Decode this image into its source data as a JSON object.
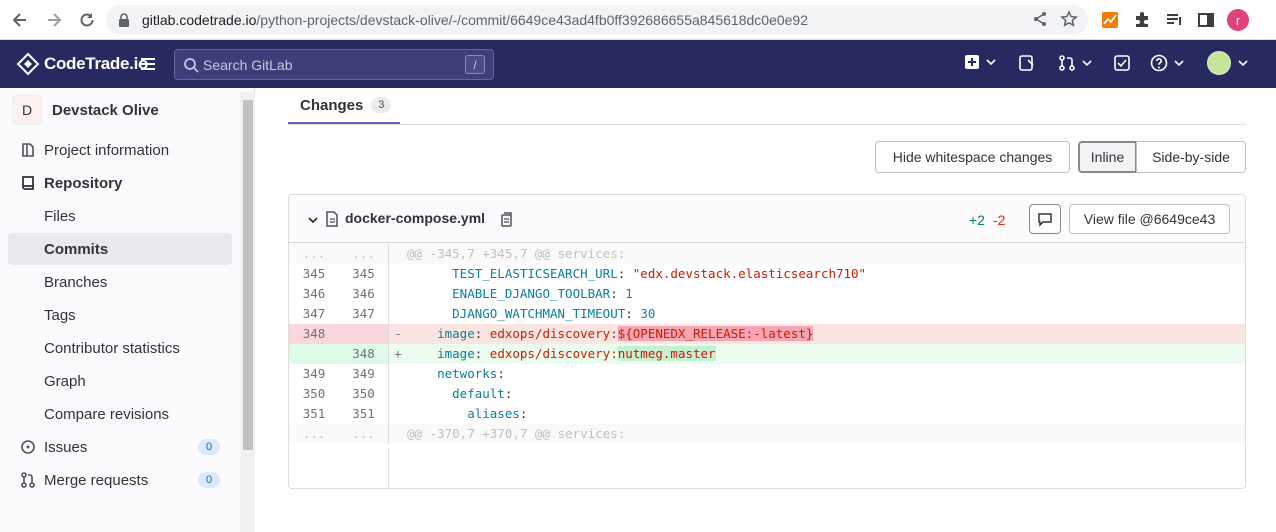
{
  "browser": {
    "url_host": "gitlab.codetrade.io",
    "url_path": "/python-projects/devstack-olive/-/commit/6649ce43ad4fb0ff392686655a845618dc0e0e92",
    "profile_initial": "r"
  },
  "topnav": {
    "logo_text": "CodeTrade.io",
    "search_placeholder": "Search GitLab",
    "search_shortcut": "/"
  },
  "sidebar": {
    "project_initial": "D",
    "project_name": "Devstack Olive",
    "items": [
      {
        "label": "Project information",
        "icon": "project-info-icon"
      },
      {
        "label": "Repository",
        "icon": "repository-icon"
      },
      {
        "label": "Files"
      },
      {
        "label": "Commits"
      },
      {
        "label": "Branches"
      },
      {
        "label": "Tags"
      },
      {
        "label": "Contributor statistics"
      },
      {
        "label": "Graph"
      },
      {
        "label": "Compare revisions"
      },
      {
        "label": "Issues",
        "icon": "issues-icon",
        "badge": "0"
      },
      {
        "label": "Merge requests",
        "icon": "merge-request-icon",
        "badge": "0"
      }
    ]
  },
  "main": {
    "tab_label": "Changes",
    "tab_count": "3",
    "hide_whitespace": "Hide whitespace changes",
    "inline": "Inline",
    "side_by_side": "Side-by-side"
  },
  "diff": {
    "file_name": "docker-compose.yml",
    "additions": "+2",
    "deletions": "-2",
    "view_file": "View file @6649ce43",
    "lines": [
      {
        "type": "match",
        "old": "...",
        "new": "...",
        "text": "@@ -345,7 +345,7 @@ services:"
      },
      {
        "type": "ctx",
        "old": "345",
        "new": "345",
        "key": "      TEST_ELASTICSEARCH_URL",
        "sep": ": ",
        "val": "\"edx.devstack.elasticsearch710\"",
        "val_class": "s"
      },
      {
        "type": "ctx",
        "old": "346",
        "new": "346",
        "key": "      ENABLE_DJANGO_TOOLBAR",
        "sep": ": ",
        "val": "1",
        "val_class": "n"
      },
      {
        "type": "ctx",
        "old": "347",
        "new": "347",
        "key": "      DJANGO_WATCHMAN_TIMEOUT",
        "sep": ": ",
        "val": "30",
        "val_class": "n"
      },
      {
        "type": "old",
        "old": "348",
        "new": "",
        "mark": "-",
        "key": "    image",
        "sep": ": ",
        "val": "edxops/discovery:",
        "hl": "${OPENEDX_RELEASE:-latest}"
      },
      {
        "type": "new",
        "old": "",
        "new": "348",
        "mark": "+",
        "key": "    image",
        "sep": ": ",
        "val": "edxops/discovery:",
        "hl": "nutmeg.master"
      },
      {
        "type": "ctx",
        "old": "349",
        "new": "349",
        "key": "    networks",
        "sep": ":",
        "val": "",
        "val_class": ""
      },
      {
        "type": "ctx",
        "old": "350",
        "new": "350",
        "key": "      default",
        "sep": ":",
        "val": "",
        "val_class": ""
      },
      {
        "type": "ctx",
        "old": "351",
        "new": "351",
        "key": "        aliases",
        "sep": ":",
        "val": "",
        "val_class": ""
      },
      {
        "type": "match",
        "old": "...",
        "new": "...",
        "text": "@@ -370,7 +370,7 @@ services:"
      }
    ]
  }
}
